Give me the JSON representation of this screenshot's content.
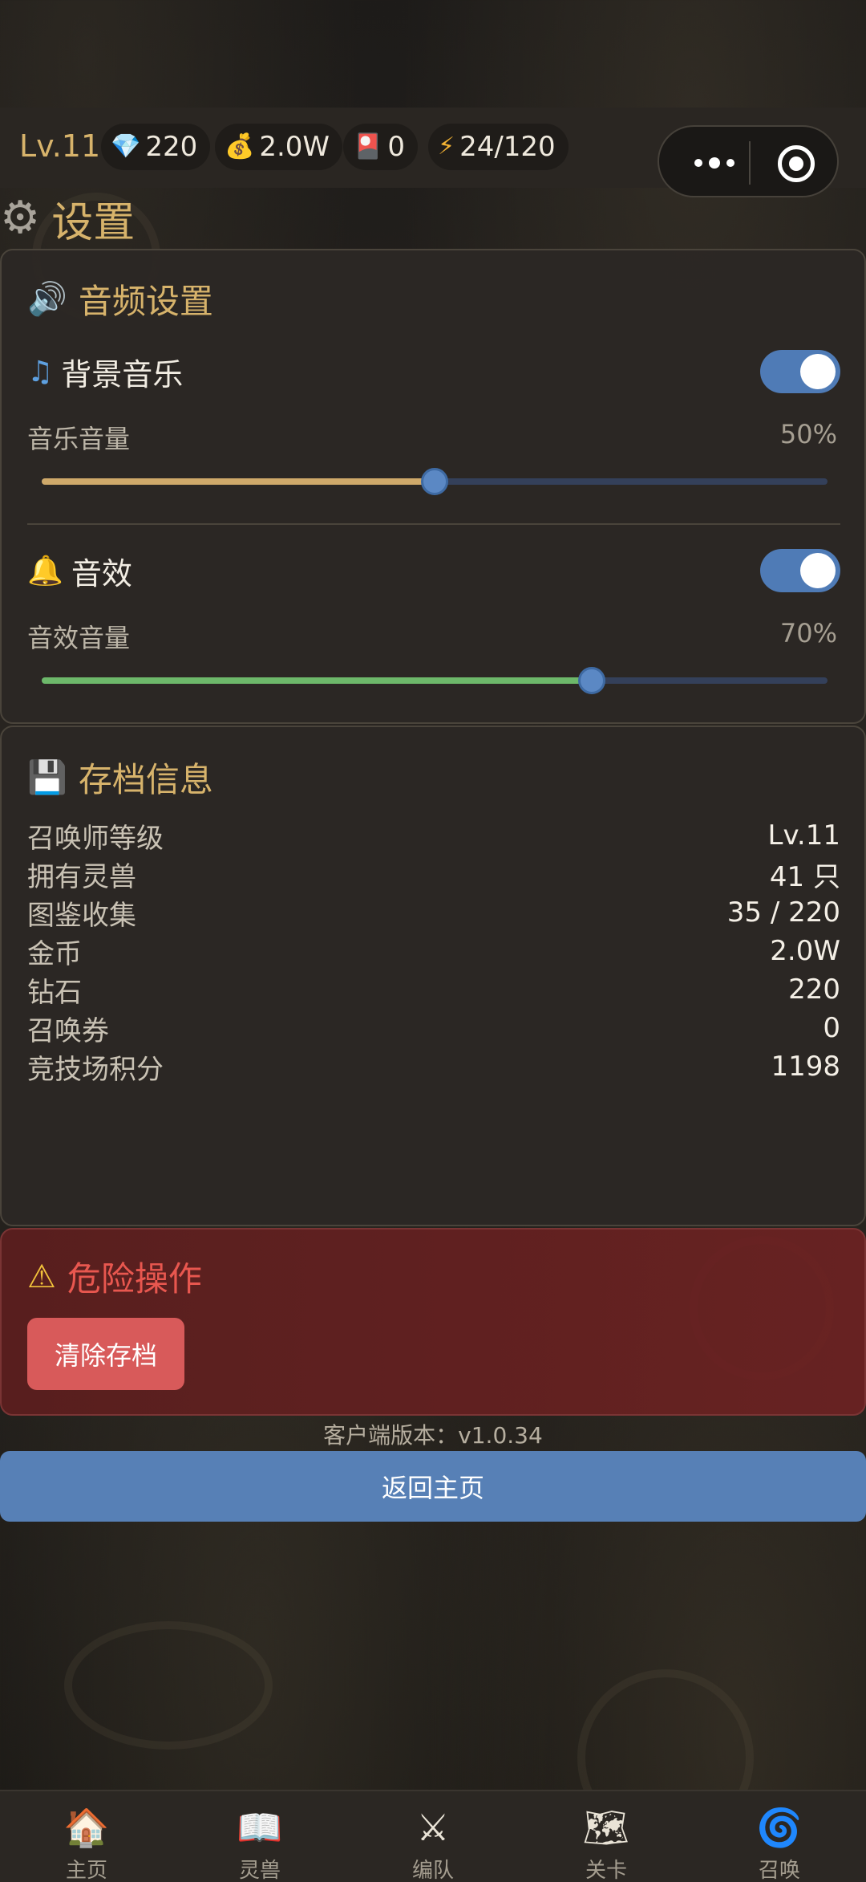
{
  "topbar": {
    "level": "Lv.11",
    "diamonds": "220",
    "coins": "2.0W",
    "tickets": "0",
    "energy": "24/120",
    "icons": {
      "diamond": "diamond-icon",
      "coin": "money-bag-icon",
      "ticket": "summon-ticket-icon",
      "energy": "lightning-icon"
    }
  },
  "page_title": "设置",
  "audio": {
    "title": "音频设置",
    "music": {
      "label": "背景音乐",
      "enabled": true,
      "volume_label": "音乐音量",
      "volume_text": "50%",
      "volume": 0.5,
      "color": "#cfa96a"
    },
    "sfx": {
      "label": "音效",
      "enabled": true,
      "volume_label": "音效音量",
      "volume_text": "70%",
      "volume": 0.7,
      "color": "#6db86a"
    }
  },
  "save_info": {
    "title": "存档信息",
    "rows": [
      {
        "key": "召唤师等级",
        "value": "Lv.11"
      },
      {
        "key": "拥有灵兽",
        "value": "41 只"
      },
      {
        "key": "图鉴收集",
        "value": "35 / 220"
      },
      {
        "key": "金币",
        "value": "2.0W"
      },
      {
        "key": "钻石",
        "value": "220"
      },
      {
        "key": "召唤券",
        "value": "0"
      },
      {
        "key": "竞技场积分",
        "value": "1198"
      }
    ]
  },
  "danger": {
    "title": "危险操作",
    "clear_label": "清除存档"
  },
  "version_text": "客户端版本：v1.0.34",
  "home_button": "返回主页",
  "nav": [
    {
      "label": "主页",
      "icon": "house-icon"
    },
    {
      "label": "灵兽",
      "icon": "book-icon"
    },
    {
      "label": "编队",
      "icon": "crossed-swords-icon"
    },
    {
      "label": "关卡",
      "icon": "map-icon"
    },
    {
      "label": "召唤",
      "icon": "swirl-icon"
    }
  ],
  "colors": {
    "accent": "#d7b36b",
    "toggle_on": "#4f7bb6",
    "danger": "#e8574f",
    "button_blue": "#5780b6"
  }
}
